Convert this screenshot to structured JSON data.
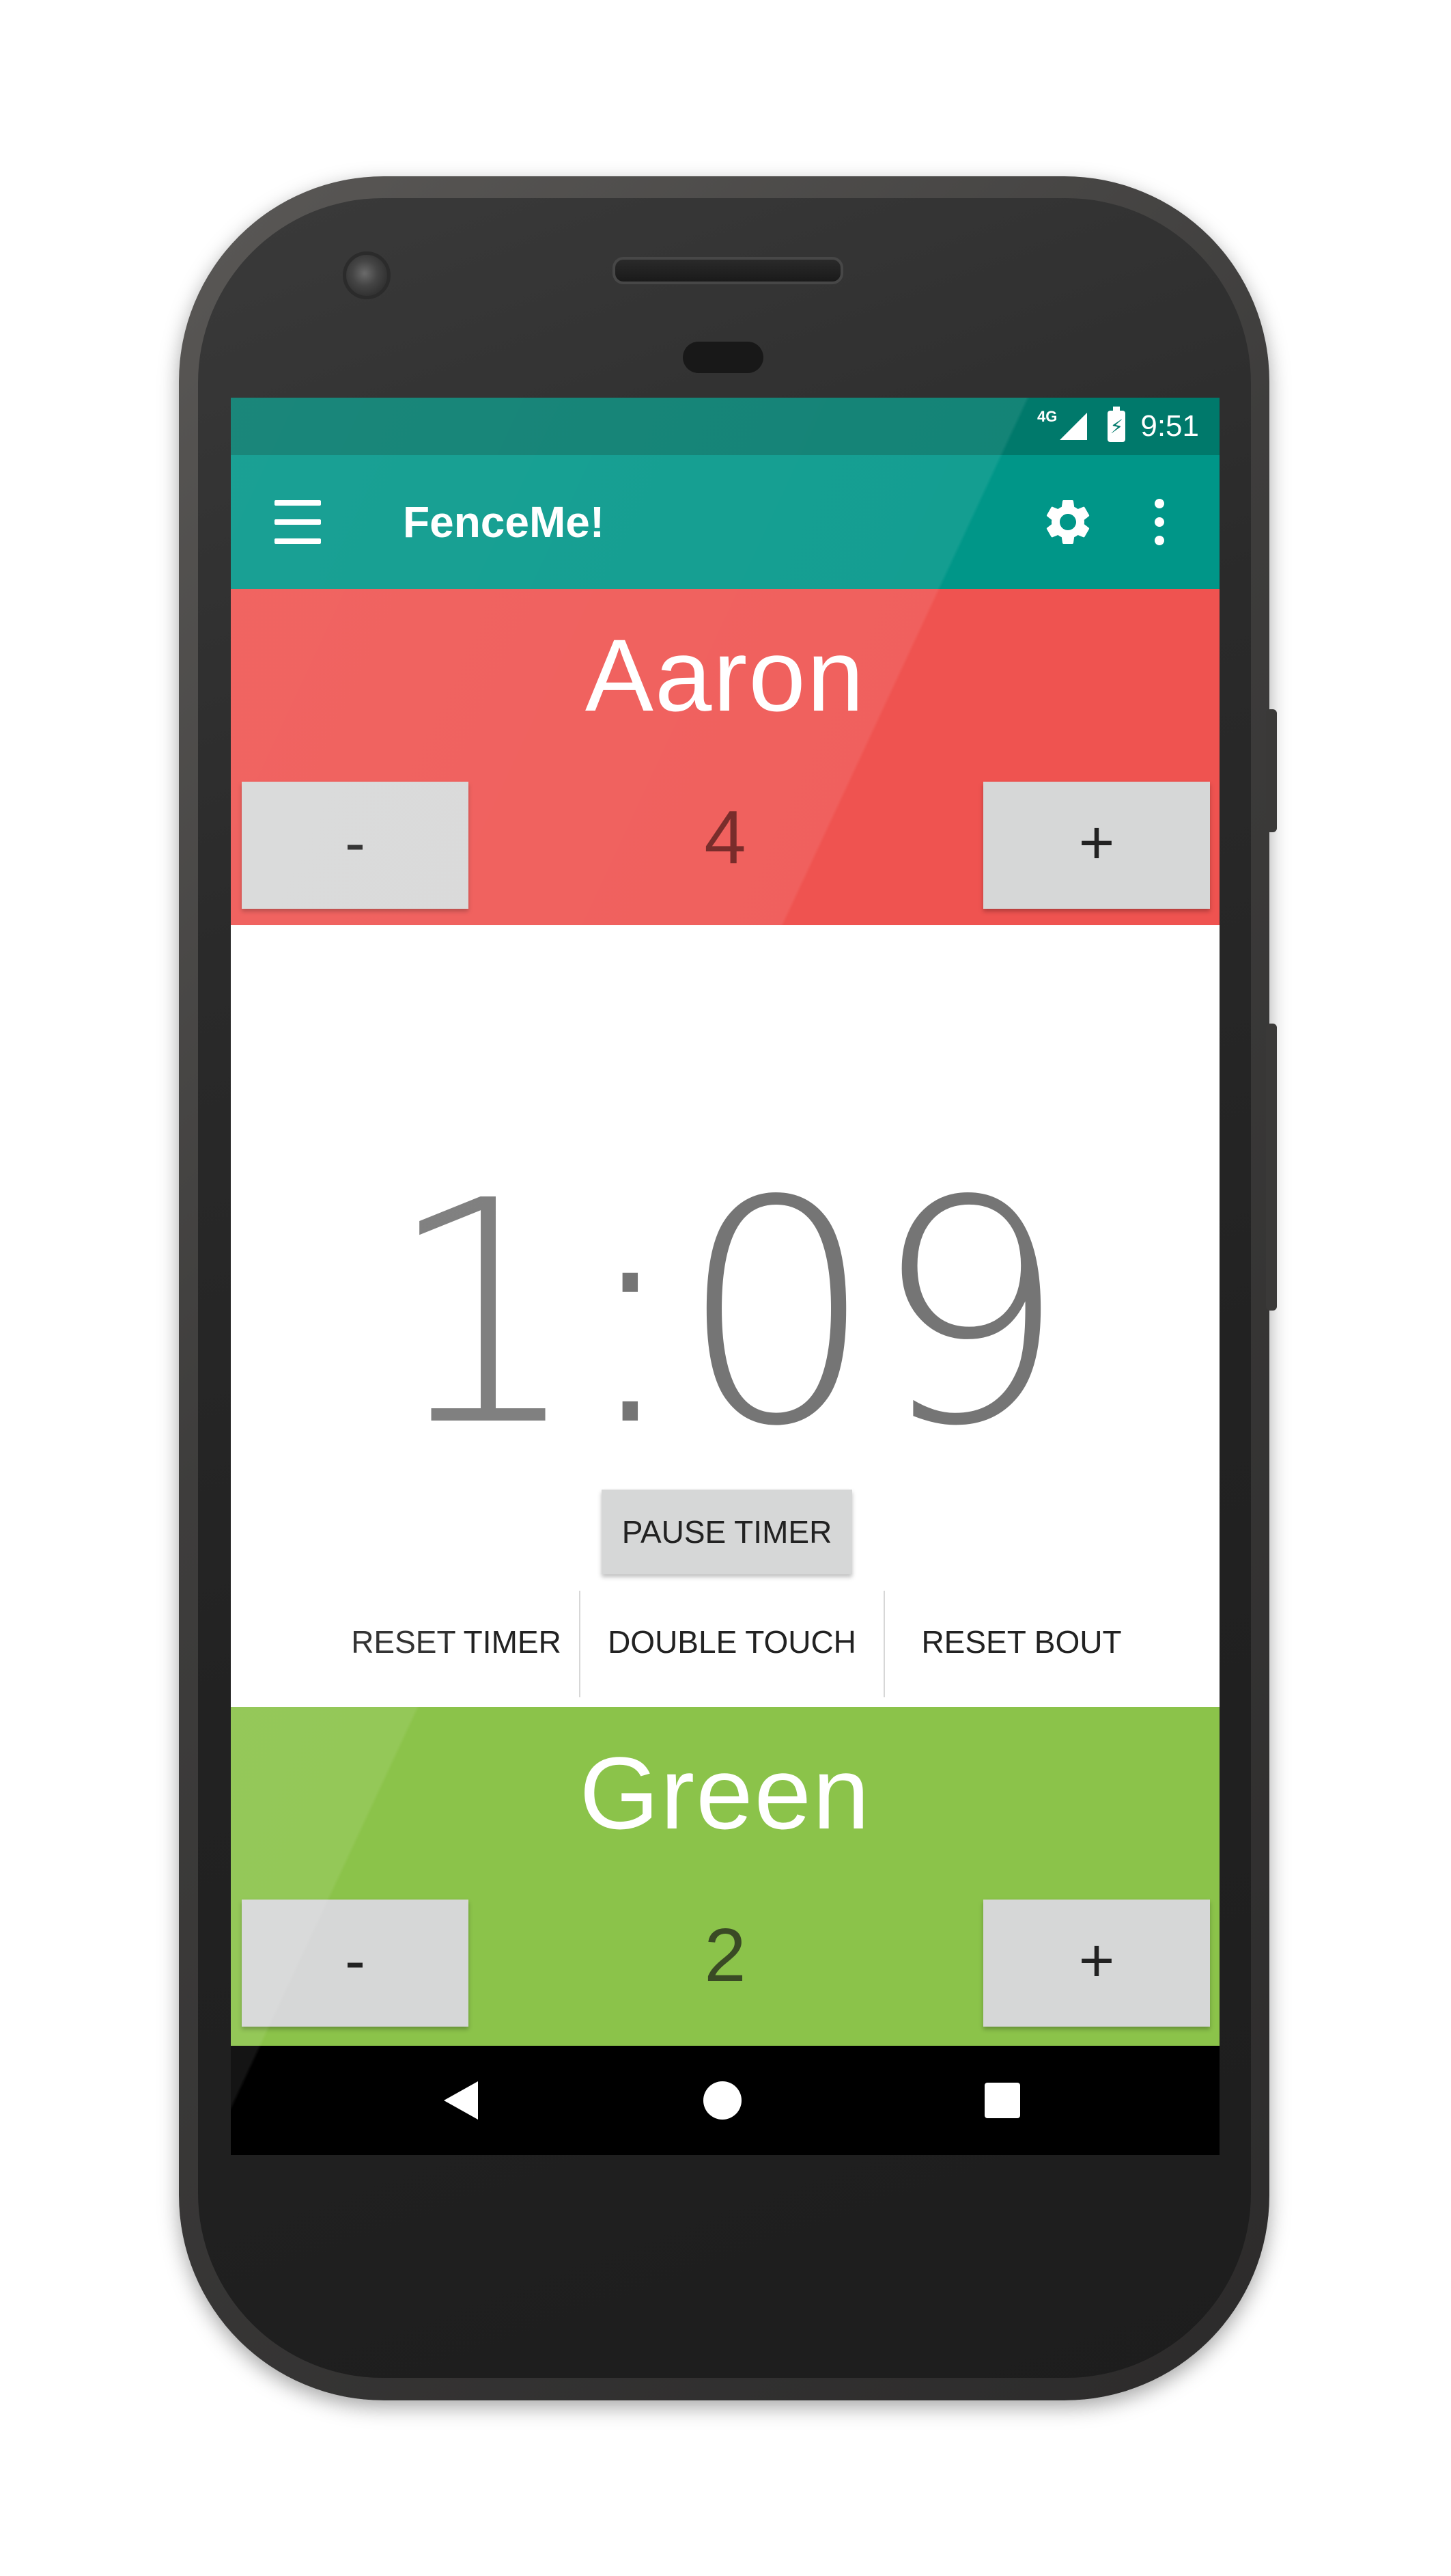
{
  "status_bar": {
    "network": "4G",
    "time": "9:51"
  },
  "app_bar": {
    "title": "FenceMe!"
  },
  "fencer_top": {
    "name": "Aaron",
    "score": "4",
    "minus_label": "-",
    "plus_label": "+",
    "color": "#ef5350"
  },
  "timer": {
    "display": "1:09",
    "pause_label": "PAUSE TIMER"
  },
  "actions": {
    "reset_timer": "RESET TIMER",
    "double_touch": "DOUBLE TOUCH",
    "reset_bout": "RESET BOUT"
  },
  "fencer_bottom": {
    "name": "Green",
    "score": "2",
    "minus_label": "-",
    "plus_label": "+",
    "color": "#8bc34a"
  },
  "theme": {
    "primary": "#009688",
    "primary_dark": "#00796b"
  },
  "icons": [
    "menu-icon",
    "gear-icon",
    "more-vert-icon",
    "signal-icon",
    "battery-icon",
    "back-icon",
    "home-icon",
    "recents-icon"
  ]
}
